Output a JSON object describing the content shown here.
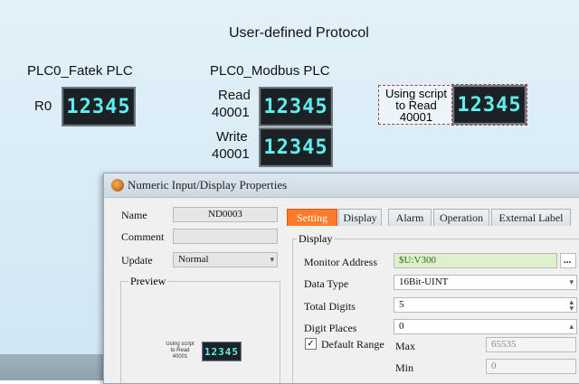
{
  "canvas": {
    "title": "User-defined Protocol",
    "fatek_header": "PLC0_Fatek PLC",
    "modbus_header": "PLC0_Modbus PLC",
    "r0_label": "R0",
    "read_label": "Read",
    "read_addr": "40001",
    "write_label": "Write",
    "write_addr": "40001",
    "script_label": "Using script to Read 40001",
    "script_line1": "Using script",
    "script_line2": "to Read",
    "script_line3": "40001",
    "lcd_value": "12345"
  },
  "dialog": {
    "title": "Numeric Input/Display Properties",
    "name_label": "Name",
    "name_value": "ND0003",
    "comment_label": "Comment",
    "comment_value": "",
    "update_label": "Update",
    "update_value": "Normal",
    "preview_label": "Preview",
    "preview_text_1": "Using script",
    "preview_text_2": "to Read",
    "preview_text_3": "40001",
    "preview_value": "12345",
    "tabs": [
      {
        "label": "Setting",
        "active": true
      },
      {
        "label": "Display",
        "active": false
      },
      {
        "label": "Alarm",
        "active": false
      },
      {
        "label": "Operation",
        "active": false
      },
      {
        "label": "External Label",
        "active": false
      }
    ],
    "display_group": "Display",
    "monitor_address_label": "Monitor Address",
    "monitor_address_value": "$U:V300",
    "browse_label": "...",
    "data_type_label": "Data Type",
    "data_type_value": "16Bit-UINT",
    "total_digits_label": "Total Digits",
    "total_digits_value": "5",
    "digit_places_label": "Digit Places",
    "digit_places_value": "0",
    "default_range_label": "Default Range",
    "default_range_checked": true,
    "max_label": "Max",
    "max_value": "65535",
    "min_label": "Min",
    "min_value": "0"
  },
  "colors": {
    "lcd_digits": "#5ef0ee",
    "active_tab": "#ff7a2a",
    "monitor_address_bg": "#dff0cf"
  }
}
